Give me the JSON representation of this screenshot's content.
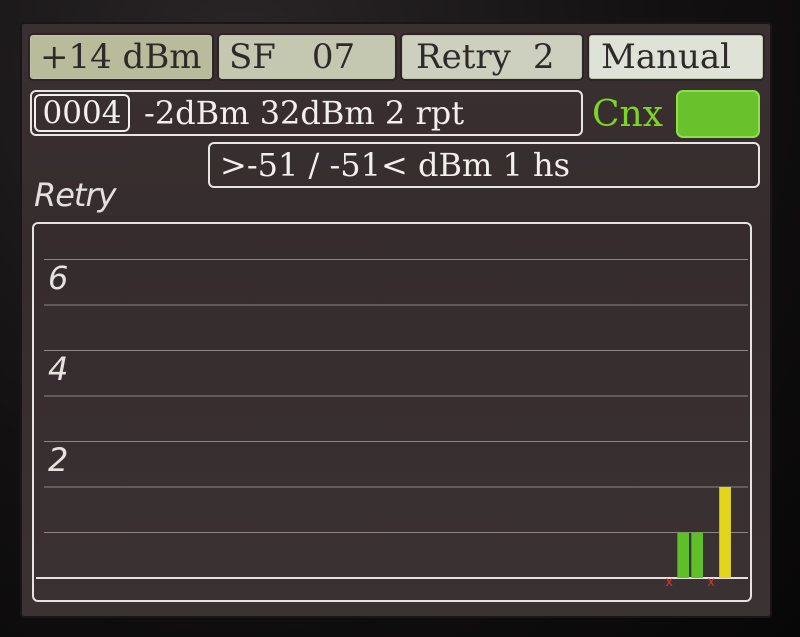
{
  "toolbar": {
    "power_label": "+14 dBm",
    "sf_label": "SF",
    "sf_value": "07",
    "retry_label": "Retry",
    "retry_value": "2",
    "mode_label": "Manual"
  },
  "status": {
    "packet_id": "0004",
    "link_info": "-2dBm 32dBm 2 rpt",
    "cnx_label": "Cnx",
    "cnx_color": "#69c22b",
    "rssi_info": ">-51 / -51< dBm 1 hs"
  },
  "colors": {
    "success_bar": "#5fbf28",
    "pending_bar": "#e3d51c",
    "fail_marker": "#e0302a"
  },
  "chart_data": {
    "type": "bar",
    "title": "Retry",
    "ylim": [
      0,
      7
    ],
    "yticks": [
      2,
      4,
      6
    ],
    "grid": true,
    "slots": 51,
    "bars": [
      {
        "slot": 45,
        "value": 0,
        "status": "fail"
      },
      {
        "slot": 46,
        "value": 1,
        "status": "success"
      },
      {
        "slot": 47,
        "value": 1,
        "status": "success"
      },
      {
        "slot": 48,
        "value": 0,
        "status": "fail"
      },
      {
        "slot": 49,
        "value": 2,
        "status": "pending"
      }
    ]
  }
}
